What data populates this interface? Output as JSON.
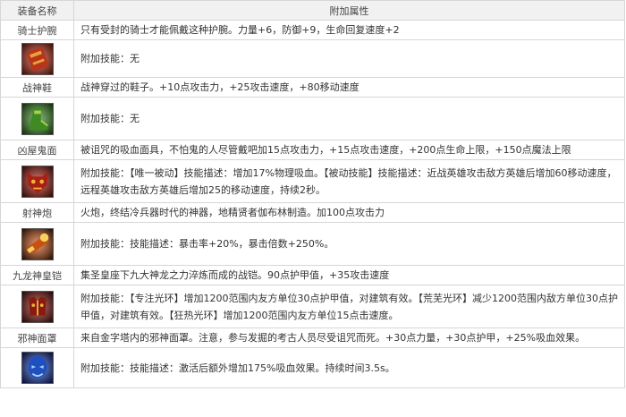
{
  "header": {
    "col_name": "装备名称",
    "col_attr": "附加属性"
  },
  "items": [
    {
      "name": "骑士护腕",
      "desc": "只有受封的骑士才能佩戴这种护腕。力量+6，防御+9，生命回复速度+2",
      "skill": "附加技能：无",
      "icon": "bracer-icon",
      "colors": [
        "#3a0a05",
        "#b8351a",
        "#e8a040"
      ]
    },
    {
      "name": "战神鞋",
      "desc": "战神穿过的鞋子。+10点攻击力，+25攻击速度，+80移动速度",
      "skill": "附加技能：无",
      "icon": "boots-icon",
      "colors": [
        "#0e2a0a",
        "#3f8a22",
        "#a8d050"
      ]
    },
    {
      "name": "凶屋鬼面",
      "desc": "被诅咒的吸血面具，不怕鬼的人尽管戴吧加15点攻击力，+15点攻击速度，+200点生命上限，+150点魔法上限",
      "skill": "附加技能：【唯一被动】技能描述：增加17%物理吸血。【被动技能】技能描述：近战英雄攻击敌方英雄后增加60移动速度，远程英雄攻击敌方英雄后增加25的移动速度，持续2秒。",
      "icon": "demon-mask-icon",
      "colors": [
        "#2a0505",
        "#a82010",
        "#f0b040"
      ]
    },
    {
      "name": "射神炮",
      "desc": "火炮，终结冷兵器时代的神器，地精贤者伽布林制造。加100点攻击力",
      "skill": "附加技能：技能描述：暴击率+20%，暴击倍数+250%。",
      "icon": "cannon-icon",
      "colors": [
        "#1e0a02",
        "#c85010",
        "#f8d060"
      ]
    },
    {
      "name": "九龙神皇铠",
      "desc": "集圣皇座下九大神龙之力淬炼而成的战铠。90点护甲值，+35攻击速度",
      "skill": "附加技能：【专注光环】增加1200范围内友方单位30点护甲值，对建筑有效。【荒芜光环】减少1200范围内敌方单位30点护甲值，对建筑有效。【狂热光环】增加1200范围内友方单位15点击速度。",
      "icon": "dragon-armor-icon",
      "colors": [
        "#200505",
        "#8a1a10",
        "#e8b040"
      ]
    },
    {
      "name": "邪神面罩",
      "desc": "来自金字塔内的邪神面罩。注意，参与发掘的考古人员尽受诅咒而死。+30点力量，+30点护甲，+25%吸血效果。",
      "skill": "附加技能：技能描述：激活后额外增加175%吸血效果。持续时间3.5s。",
      "icon": "evil-mask-icon",
      "colors": [
        "#050a30",
        "#2050c0",
        "#a0d0f8"
      ]
    }
  ]
}
